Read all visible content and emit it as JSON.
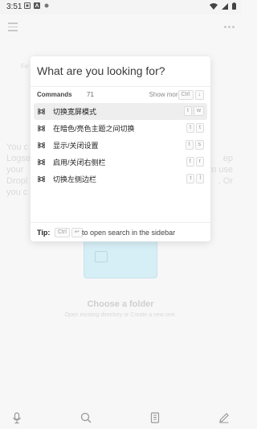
{
  "status_bar": {
    "time": "3:51"
  },
  "background": {
    "fe_text": "Fe",
    "left_lines": [
      "You c",
      "Logse",
      "your",
      "Dropl",
      "you c"
    ],
    "right_lines": [
      "ep",
      "to use",
      ". Or"
    ],
    "choose_title": "Choose a folder",
    "choose_subtitle": "Open existing directory or Create a new one."
  },
  "palette": {
    "search_placeholder": "What are you looking for?",
    "group": {
      "title": "Commands",
      "count": "71",
      "show_more": "Show more",
      "show_more_keys": [
        "Ctrl",
        "↓"
      ]
    },
    "commands": [
      {
        "label": "切换宽屏模式",
        "keys": [
          "t",
          "w"
        ],
        "selected": true
      },
      {
        "label": "在暗色/亮色主题之间切换",
        "keys": [
          "t",
          "t"
        ]
      },
      {
        "label": "显示/关闭设置",
        "keys": [
          "t",
          "s"
        ]
      },
      {
        "label": "启用/关闭右侧栏",
        "keys": [
          "t",
          "r"
        ]
      },
      {
        "label": "切换左侧边栏",
        "keys": [
          "t",
          "l"
        ]
      }
    ],
    "tip": {
      "label": "Tip:",
      "keys": [
        "Ctrl",
        "↩"
      ],
      "text": "to open search in the sidebar"
    }
  },
  "icons": {
    "command": "command-key-icon",
    "mic": "microphone-icon",
    "search": "search-icon",
    "journal": "journal-icon",
    "edit": "pencil-icon"
  },
  "colors": {
    "accent": "#d6eef5",
    "selected_row": "#eeeeee"
  }
}
